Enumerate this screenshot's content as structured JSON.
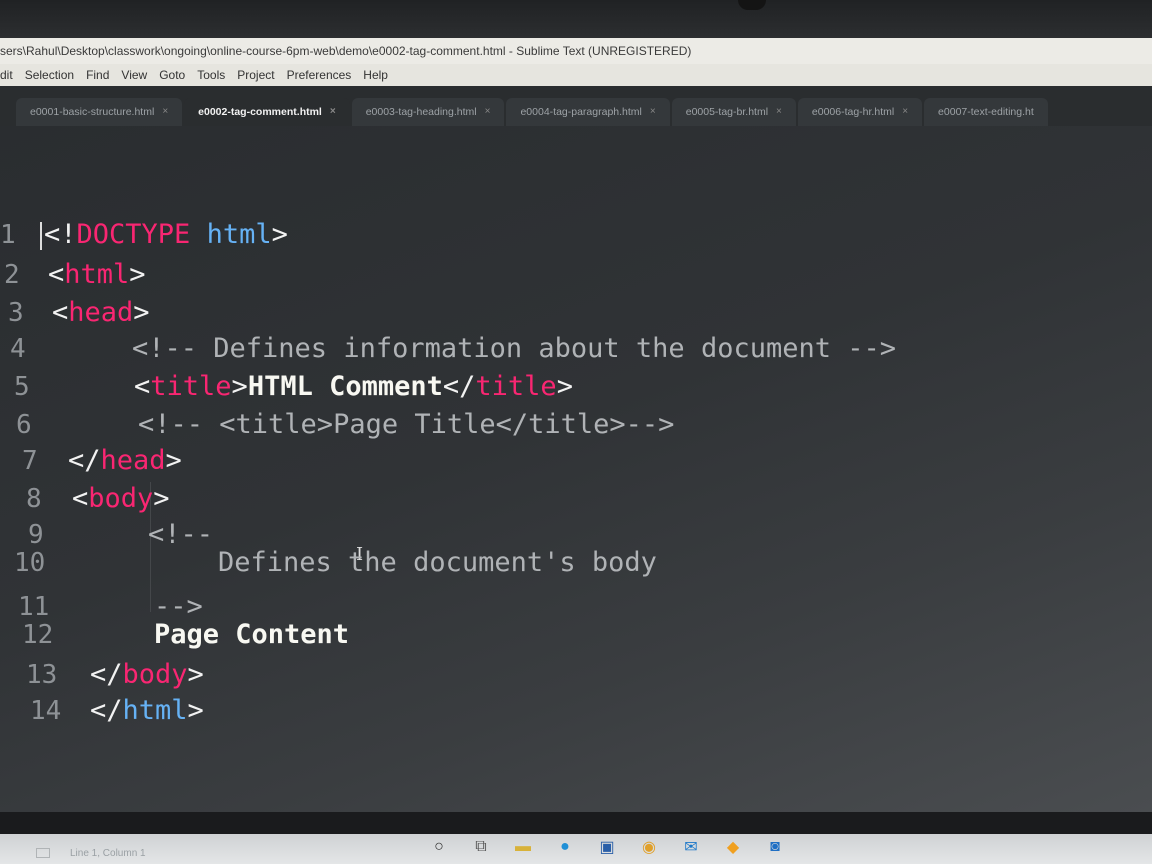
{
  "window": {
    "title": "sers\\Rahul\\Desktop\\classwork\\ongoing\\online-course-6pm-web\\demo\\e0002-tag-comment.html - Sublime Text (UNREGISTERED)"
  },
  "menu": [
    "dit",
    "Selection",
    "Find",
    "View",
    "Goto",
    "Tools",
    "Project",
    "Preferences",
    "Help"
  ],
  "tabs": [
    {
      "label": "e0001-basic-structure.html",
      "active": false
    },
    {
      "label": "e0002-tag-comment.html",
      "active": true
    },
    {
      "label": "e0003-tag-heading.html",
      "active": false
    },
    {
      "label": "e0004-tag-paragraph.html",
      "active": false
    },
    {
      "label": "e0005-tag-br.html",
      "active": false
    },
    {
      "label": "e0006-tag-hr.html",
      "active": false
    },
    {
      "label": "e0007-text-editing.ht",
      "active": false
    }
  ],
  "tab_close": "×",
  "editor": {
    "lines": [
      {
        "num": "1",
        "tokens": [
          [
            "tag",
            "<!"
          ],
          [
            "kw",
            "DOCTYPE"
          ],
          [
            "tag",
            " "
          ],
          [
            "attr",
            "html"
          ],
          [
            "tag",
            ">"
          ]
        ]
      },
      {
        "num": "2",
        "tokens": [
          [
            "tag",
            "<"
          ],
          [
            "kw",
            "html"
          ],
          [
            "tag",
            ">"
          ]
        ]
      },
      {
        "num": "3",
        "tokens": [
          [
            "tag",
            "<"
          ],
          [
            "kw",
            "head"
          ],
          [
            "tag",
            ">"
          ]
        ]
      },
      {
        "num": "4",
        "tokens": [
          [
            "cm",
            "<!-- Defines information about the document -->"
          ]
        ]
      },
      {
        "num": "5",
        "tokens": [
          [
            "tag",
            "<"
          ],
          [
            "kw",
            "title"
          ],
          [
            "tag",
            ">"
          ],
          [
            "txt",
            "HTML Comment"
          ],
          [
            "tag",
            "</"
          ],
          [
            "kw",
            "title"
          ],
          [
            "tag",
            ">"
          ]
        ]
      },
      {
        "num": "6",
        "tokens": [
          [
            "cm",
            "<!-- <title>Page Title</title>-->"
          ]
        ]
      },
      {
        "num": "7",
        "tokens": [
          [
            "tag",
            "</"
          ],
          [
            "kw",
            "head"
          ],
          [
            "tag",
            ">"
          ]
        ]
      },
      {
        "num": "8",
        "tokens": [
          [
            "tag",
            "<"
          ],
          [
            "kw",
            "body"
          ],
          [
            "tag",
            ">"
          ]
        ]
      },
      {
        "num": "9",
        "tokens": [
          [
            "cm",
            "<!--"
          ]
        ]
      },
      {
        "num": "10",
        "tokens": [
          [
            "cm",
            "Defines the document's body"
          ]
        ]
      },
      {
        "num": "11",
        "tokens": [
          [
            "cm",
            "-->"
          ]
        ]
      },
      {
        "num": "12",
        "tokens": [
          [
            "txt",
            "Page Content"
          ]
        ]
      },
      {
        "num": "13",
        "tokens": [
          [
            "tag",
            "</"
          ],
          [
            "kw",
            "body"
          ],
          [
            "tag",
            ">"
          ]
        ]
      },
      {
        "num": "14",
        "tokens": [
          [
            "tag",
            "</"
          ],
          [
            "attr",
            "html"
          ],
          [
            "tag",
            ">"
          ]
        ]
      }
    ]
  },
  "status": {
    "position": "Line 1, Column 1"
  },
  "colors": {
    "keyword": "#f92672",
    "doctype_attr": "#66b2f5",
    "comment": "#b0b3b6",
    "text": "#f8f8f2"
  },
  "taskbar_icons": [
    "search-circle-icon",
    "task-view-icon",
    "file-explorer-icon",
    "edge-icon",
    "store-icon",
    "chrome-icon",
    "mail-icon",
    "sublime-icon",
    "app-icon"
  ]
}
